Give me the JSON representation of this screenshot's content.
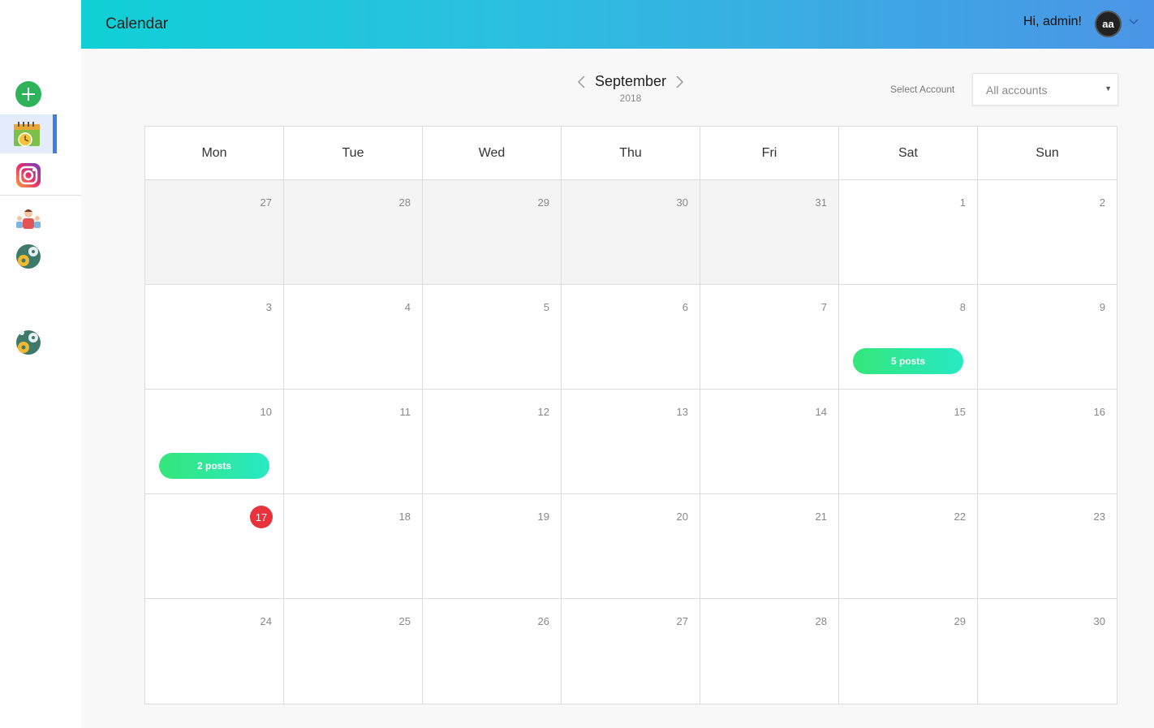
{
  "header": {
    "title": "Calendar",
    "greeting": "Hi, admin!",
    "avatar_initials": "aa",
    "gradient": [
      "#10d0d6",
      "#4b95e6"
    ]
  },
  "sidebar": {
    "items": [
      {
        "name": "add",
        "icon": "plus-circle-icon",
        "active": false
      },
      {
        "name": "calendar",
        "icon": "calendar-clock-icon",
        "active": true
      },
      {
        "name": "instagram",
        "icon": "instagram-icon",
        "active": false
      },
      {
        "name": "users",
        "icon": "users-icon",
        "active": false
      },
      {
        "name": "settings",
        "icon": "gear-globe-icon",
        "active": false
      },
      {
        "name": "settings-2",
        "icon": "gear-globe-icon",
        "active": false
      }
    ],
    "active_color": "#3d7fe0"
  },
  "month_nav": {
    "month": "September",
    "year": "2018"
  },
  "account_filter": {
    "label": "Select Account",
    "value": "All accounts"
  },
  "calendar": {
    "weekdays": [
      "Mon",
      "Tue",
      "Wed",
      "Thu",
      "Fri",
      "Sat",
      "Sun"
    ],
    "weeks": [
      [
        {
          "day": "27",
          "muted": true
        },
        {
          "day": "28",
          "muted": true
        },
        {
          "day": "29",
          "muted": true
        },
        {
          "day": "30",
          "muted": true
        },
        {
          "day": "31",
          "muted": true
        },
        {
          "day": "1"
        },
        {
          "day": "2"
        }
      ],
      [
        {
          "day": "3"
        },
        {
          "day": "4"
        },
        {
          "day": "5"
        },
        {
          "day": "6"
        },
        {
          "day": "7"
        },
        {
          "day": "8",
          "posts": "5 posts"
        },
        {
          "day": "9"
        }
      ],
      [
        {
          "day": "10",
          "posts": "2 posts"
        },
        {
          "day": "11"
        },
        {
          "day": "12"
        },
        {
          "day": "13"
        },
        {
          "day": "14"
        },
        {
          "day": "15"
        },
        {
          "day": "16"
        }
      ],
      [
        {
          "day": "17",
          "today": true
        },
        {
          "day": "18"
        },
        {
          "day": "19"
        },
        {
          "day": "20"
        },
        {
          "day": "21"
        },
        {
          "day": "22"
        },
        {
          "day": "23"
        }
      ],
      [
        {
          "day": "24"
        },
        {
          "day": "25"
        },
        {
          "day": "26"
        },
        {
          "day": "27"
        },
        {
          "day": "28"
        },
        {
          "day": "29"
        },
        {
          "day": "30"
        }
      ]
    ],
    "colors": {
      "today": "#e8323c",
      "pill_start": "#35e67b",
      "pill_end": "#27e9c4",
      "muted_bg": "#f4f4f4"
    }
  }
}
